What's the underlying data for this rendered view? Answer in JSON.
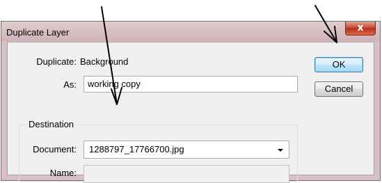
{
  "dialog": {
    "title": "Duplicate Layer",
    "close_glyph": "x"
  },
  "form": {
    "duplicate_label": "Duplicate:",
    "duplicate_value": "Background",
    "as_label": "As:",
    "as_value": "working copy",
    "destination_legend": "Destination",
    "document_label": "Document:",
    "document_value": "1288797_17766700.jpg",
    "name_label": "Name:",
    "name_value": ""
  },
  "buttons": {
    "ok": "OK",
    "cancel": "Cancel"
  },
  "icons": {
    "close": "close-icon",
    "dropdown": "chevron-down-icon",
    "annotation": "arrow-icon"
  },
  "colors": {
    "frame": "#d9c0c4",
    "close_button": "#c7452e",
    "default_button": "#bee6fd",
    "annotation": "#000000"
  }
}
